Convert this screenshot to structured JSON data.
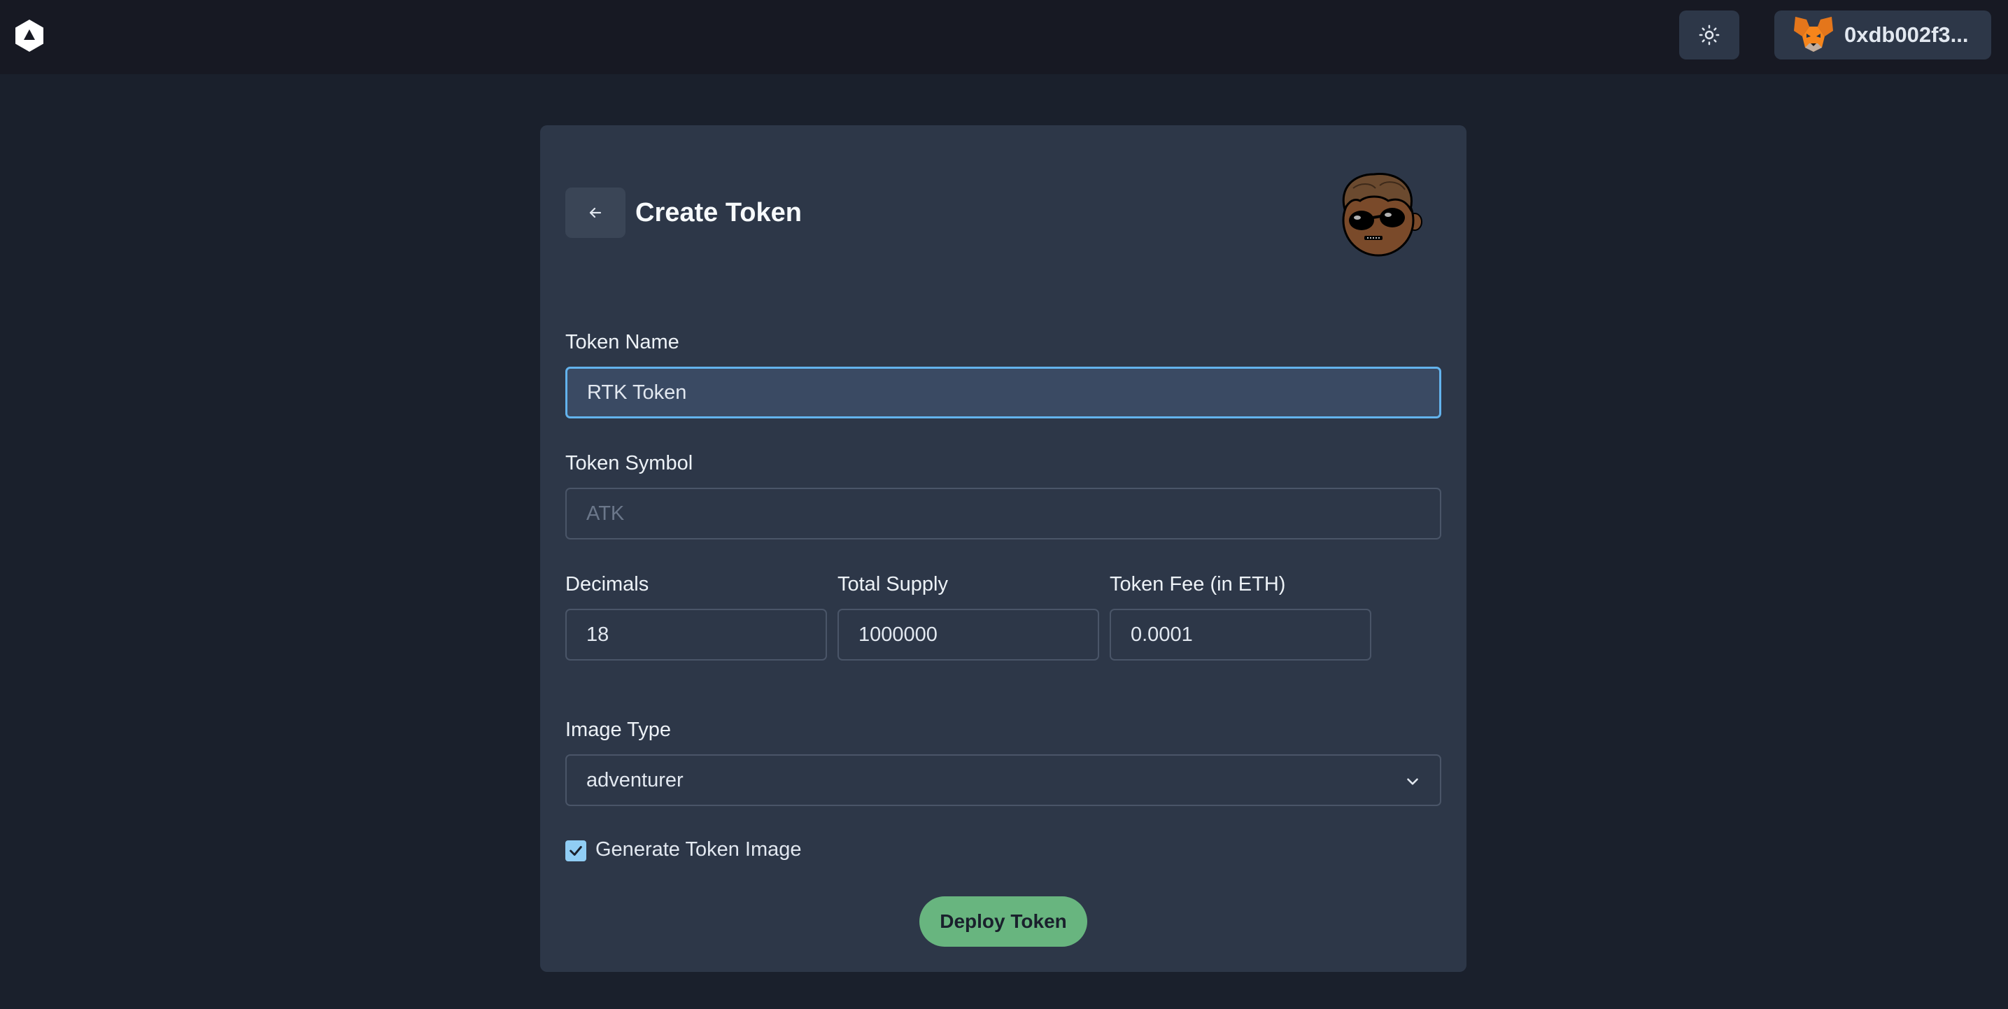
{
  "header": {
    "logo_icon": "hexagon-logo-icon",
    "theme_icon": "sun-icon",
    "wallet": {
      "icon": "metamask-fox-icon",
      "address": "0xdb002f3..."
    }
  },
  "form": {
    "title": "Create Token",
    "back_icon": "arrow-left-icon",
    "avatar_icon": "token-avatar-icon",
    "token_name": {
      "label": "Token Name",
      "value": "RTK Token"
    },
    "token_symbol": {
      "label": "Token Symbol",
      "placeholder": "ATK",
      "value": ""
    },
    "decimals": {
      "label": "Decimals",
      "value": "18"
    },
    "total_supply": {
      "label": "Total Supply",
      "value": "1000000"
    },
    "token_fee": {
      "label": "Token Fee (in ETH)",
      "value": "0.0001"
    },
    "image_type": {
      "label": "Image Type",
      "selected": "adventurer"
    },
    "generate_image": {
      "label": "Generate Token Image",
      "checked": true
    },
    "deploy_label": "Deploy Token"
  },
  "colors": {
    "accent_focus": "#63b3ed",
    "deploy_green": "#68b57f",
    "card_bg": "#2d3748",
    "page_bg": "#1a202c"
  }
}
